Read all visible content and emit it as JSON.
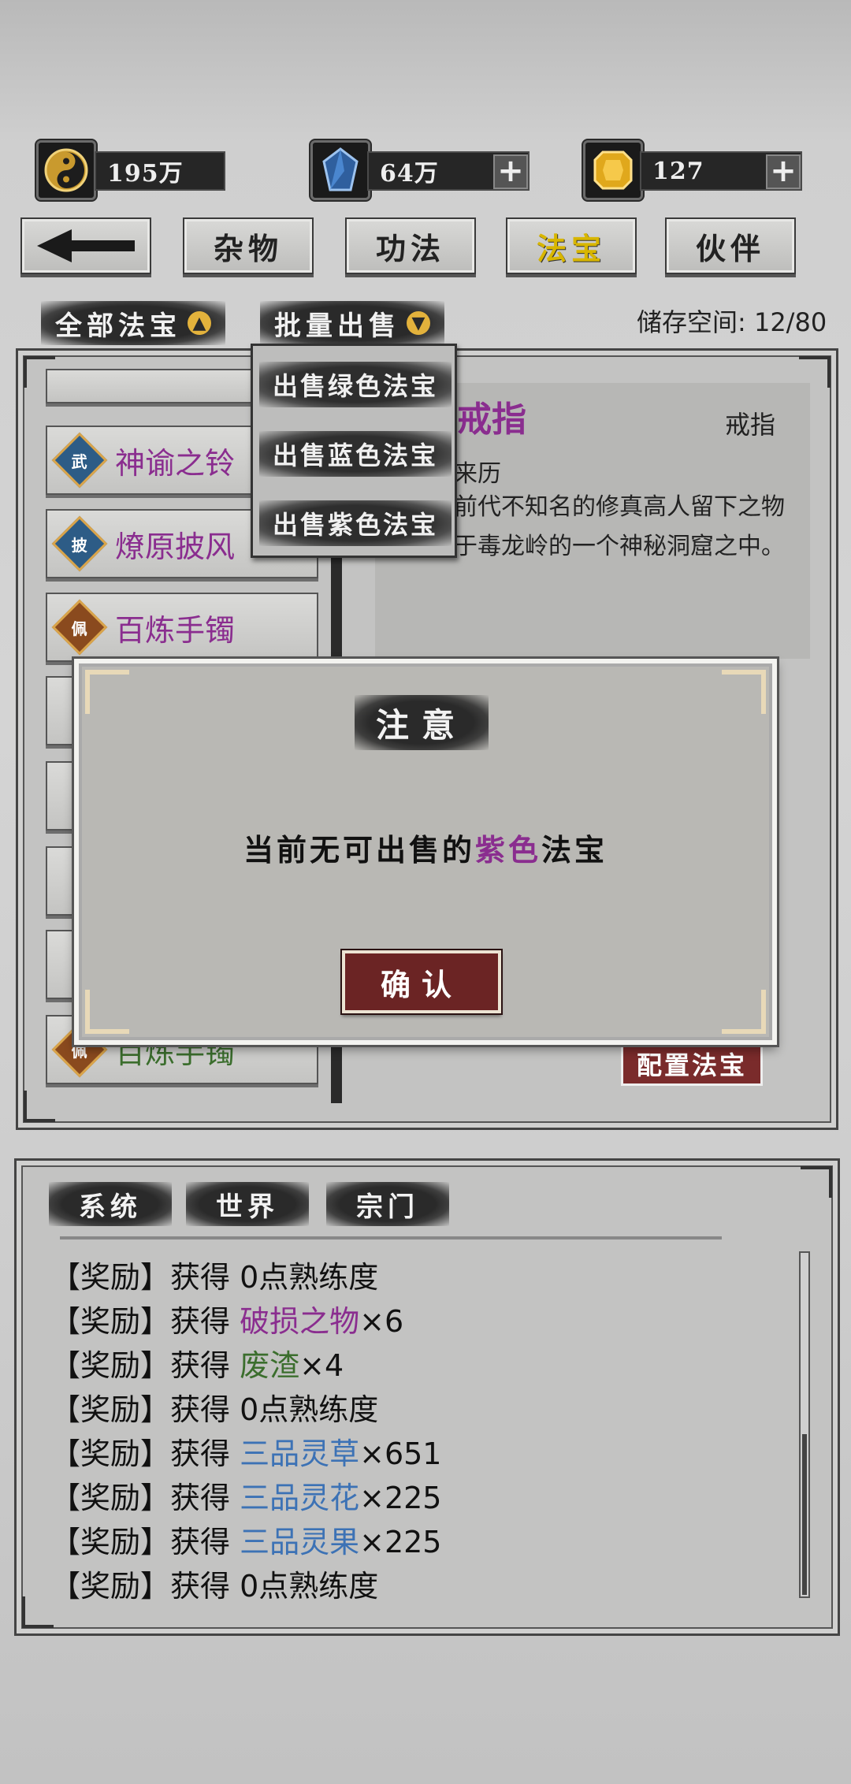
{
  "currency": {
    "coins": "195万",
    "crystals": "64万",
    "gold": "127",
    "plus": "+"
  },
  "tabs": {
    "back": "back",
    "items": [
      "杂物",
      "功法",
      "法宝",
      "伙伴"
    ],
    "active": "法宝"
  },
  "filter": {
    "all_treasures": "全部法宝",
    "batch_sell": "批量出售",
    "storage": "储存空间: 12/80"
  },
  "dropdown": {
    "items": [
      "出售绿色法宝",
      "出售蓝色法宝",
      "出售紫色法宝"
    ]
  },
  "list": {
    "items": [
      {
        "label": "神谕之铃",
        "badge": "武",
        "color": "#8a2d8f"
      },
      {
        "label": "燎原披风",
        "badge": "披",
        "color": "#8a2d8f"
      },
      {
        "label": "百炼手镯",
        "badge": "佩",
        "color": "#8a2d8f"
      },
      {
        "label": "百炼手镯",
        "badge": "佩",
        "color": "#3b6e2d"
      }
    ]
  },
  "detail": {
    "name": "戒指",
    "type": "戒指",
    "origin_label": "来历",
    "description_1": "前代不知名的修真高人留下之物",
    "description_2": "于毒龙岭的一个神秘洞窟之中。",
    "equip_button": "配置法宝"
  },
  "dialog": {
    "title": "注意",
    "message_prefix": "当前无可出售的",
    "message_highlight": "紫色",
    "message_suffix": "法宝",
    "confirm": "确认",
    "highlight_color": "#8a2d8f"
  },
  "chat": {
    "tabs": [
      "系统",
      "世界",
      "宗门"
    ],
    "lines": [
      {
        "prefix": "【奖励】获得 ",
        "item": "0点熟练度",
        "qty": "",
        "color": ""
      },
      {
        "prefix": "【奖励】获得 ",
        "item": "破损之物",
        "qty": "×6",
        "color": "purple"
      },
      {
        "prefix": "【奖励】获得 ",
        "item": "废渣",
        "qty": "×4",
        "color": "green"
      },
      {
        "prefix": "【奖励】获得 ",
        "item": "0点熟练度",
        "qty": "",
        "color": ""
      },
      {
        "prefix": "【奖励】获得 ",
        "item": "三品灵草",
        "qty": "×651",
        "color": "blue"
      },
      {
        "prefix": "【奖励】获得 ",
        "item": "三品灵花",
        "qty": "×225",
        "color": "blue"
      },
      {
        "prefix": "【奖励】获得 ",
        "item": "三品灵果",
        "qty": "×225",
        "color": "blue"
      },
      {
        "prefix": "【奖励】获得 ",
        "item": "0点熟练度",
        "qty": "",
        "color": ""
      }
    ]
  }
}
